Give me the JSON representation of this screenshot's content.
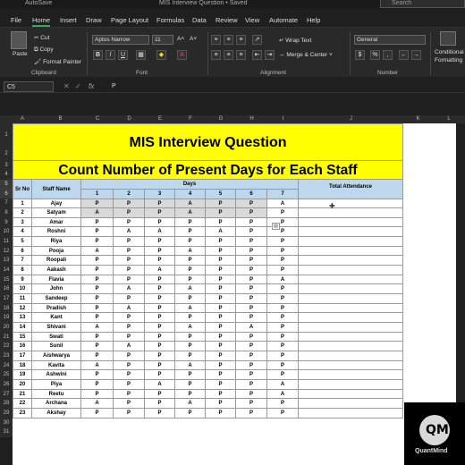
{
  "titlebar": {
    "autosave": "AutoSave",
    "doc_title": "MIS Interview Question • Saved",
    "search": "Search"
  },
  "menu": [
    "File",
    "Home",
    "Insert",
    "Draw",
    "Page Layout",
    "Formulas",
    "Data",
    "Review",
    "View",
    "Automate",
    "Help"
  ],
  "ribbon": {
    "paste": "Paste",
    "cut": "Cut",
    "copy": "Copy",
    "format_painter": "Format Painter",
    "clipboard": "Clipboard",
    "font_name": "Aptos Narrow",
    "font_size": "11",
    "font": "Font",
    "wrap_text": "Wrap Text",
    "merge_center": "Merge & Center",
    "alignment": "Alignment",
    "number_format": "General",
    "number": "Number",
    "conditional": "Conditional",
    "formatting": "Formatting"
  },
  "formula_bar": {
    "cell": "C5",
    "fx": "fx",
    "value": "P"
  },
  "columns": [
    "A",
    "B",
    "C",
    "D",
    "E",
    "F",
    "G",
    "H",
    "I",
    "J",
    "K",
    "L"
  ],
  "sheet": {
    "title1": "MIS Interview Question",
    "title2": "Count Number of Present Days for Each Staff",
    "h_srno": "Sr No",
    "h_staff": "Staff Name",
    "h_days": "Days",
    "h_total": "Total Attendance",
    "day_numbers": [
      "1",
      "2",
      "3",
      "4",
      "5",
      "6",
      "7"
    ],
    "rows": [
      {
        "sr": "1",
        "name": "Ajay",
        "days": [
          "P",
          "P",
          "P",
          "A",
          "P",
          "P",
          "A"
        ]
      },
      {
        "sr": "2",
        "name": "Satyam",
        "days": [
          "A",
          "P",
          "P",
          "A",
          "P",
          "P",
          "P"
        ]
      },
      {
        "sr": "3",
        "name": "Amar",
        "days": [
          "P",
          "P",
          "P",
          "P",
          "P",
          "P",
          "P"
        ]
      },
      {
        "sr": "4",
        "name": "Roshni",
        "days": [
          "P",
          "A",
          "A",
          "P",
          "A",
          "P",
          "P"
        ]
      },
      {
        "sr": "5",
        "name": "Riya",
        "days": [
          "P",
          "P",
          "P",
          "P",
          "P",
          "P",
          "P"
        ]
      },
      {
        "sr": "6",
        "name": "Pooja",
        "days": [
          "A",
          "P",
          "P",
          "A",
          "P",
          "P",
          "P"
        ]
      },
      {
        "sr": "7",
        "name": "Roopali",
        "days": [
          "P",
          "P",
          "P",
          "P",
          "P",
          "P",
          "P"
        ]
      },
      {
        "sr": "8",
        "name": "Aakash",
        "days": [
          "P",
          "P",
          "A",
          "P",
          "P",
          "P",
          "P"
        ]
      },
      {
        "sr": "9",
        "name": "Flavia",
        "days": [
          "P",
          "P",
          "P",
          "P",
          "P",
          "P",
          "A"
        ]
      },
      {
        "sr": "10",
        "name": "John",
        "days": [
          "P",
          "A",
          "P",
          "A",
          "P",
          "P",
          "P"
        ]
      },
      {
        "sr": "11",
        "name": "Sandeep",
        "days": [
          "P",
          "P",
          "P",
          "P",
          "P",
          "P",
          "P"
        ]
      },
      {
        "sr": "12",
        "name": "Pradish",
        "days": [
          "P",
          "A",
          "P",
          "A",
          "P",
          "P",
          "P"
        ]
      },
      {
        "sr": "13",
        "name": "Kant",
        "days": [
          "P",
          "P",
          "P",
          "P",
          "P",
          "P",
          "P"
        ]
      },
      {
        "sr": "14",
        "name": "Shivani",
        "days": [
          "A",
          "P",
          "P",
          "A",
          "P",
          "A",
          "P"
        ]
      },
      {
        "sr": "15",
        "name": "Swati",
        "days": [
          "P",
          "P",
          "P",
          "P",
          "P",
          "P",
          "P"
        ]
      },
      {
        "sr": "16",
        "name": "Sunil",
        "days": [
          "P",
          "A",
          "P",
          "P",
          "P",
          "P",
          "P"
        ]
      },
      {
        "sr": "17",
        "name": "Aishwarya",
        "days": [
          "P",
          "P",
          "P",
          "P",
          "P",
          "P",
          "P"
        ]
      },
      {
        "sr": "18",
        "name": "Kavita",
        "days": [
          "A",
          "P",
          "P",
          "A",
          "P",
          "P",
          "P"
        ]
      },
      {
        "sr": "19",
        "name": "Ashwini",
        "days": [
          "P",
          "P",
          "P",
          "P",
          "P",
          "P",
          "P"
        ]
      },
      {
        "sr": "20",
        "name": "Piya",
        "days": [
          "P",
          "P",
          "A",
          "P",
          "P",
          "P",
          "A"
        ]
      },
      {
        "sr": "21",
        "name": "Reetu",
        "days": [
          "P",
          "P",
          "P",
          "P",
          "P",
          "P",
          "A"
        ]
      },
      {
        "sr": "22",
        "name": "Archana",
        "days": [
          "A",
          "P",
          "P",
          "A",
          "P",
          "P",
          "P"
        ]
      },
      {
        "sr": "23",
        "name": "Akshay",
        "days": [
          "P",
          "P",
          "P",
          "P",
          "P",
          "P",
          "P"
        ]
      }
    ]
  },
  "row_numbers": [
    "1",
    "2",
    "3",
    "4",
    "5",
    "6",
    "7",
    "8",
    "9",
    "10",
    "11",
    "12",
    "13",
    "14",
    "15",
    "16",
    "17",
    "18",
    "19",
    "20",
    "21",
    "22",
    "23",
    "24",
    "25",
    "26",
    "27",
    "28",
    "29",
    "30",
    "31"
  ],
  "logo": {
    "mark": "QM",
    "name": "QuantMind"
  },
  "colors": {
    "title_bg": "#ffff00",
    "header_bg": "#bdd7ee",
    "selection": "#d9d9d9",
    "accent": "#3ba55c"
  }
}
